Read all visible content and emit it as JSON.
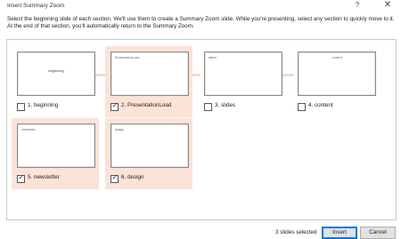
{
  "window": {
    "title": "Insert Summary Zoom",
    "help_glyph": "?",
    "close_glyph": "✕"
  },
  "instructions": "Select the beginning slide of each section. We'll use them to create a Summary Zoom slide. While you're presenting, select any section to quickly move to it. At the end of that section, you'll automatically return to the Summary Zoom.",
  "sections": [
    {
      "label": "1. beginning",
      "thumb_text": "beginning",
      "checked": false
    },
    {
      "label": "2. PresentationLoad",
      "thumb_text": "PresentationLoad",
      "checked": true
    },
    {
      "label": "3. slides",
      "thumb_text": "slides",
      "checked": false
    },
    {
      "label": "4. content",
      "thumb_text": "content",
      "checked": false
    },
    {
      "label": "5. newsletter",
      "thumb_text": "newsletter",
      "checked": true
    },
    {
      "label": "6. design",
      "thumb_text": "design",
      "checked": true
    }
  ],
  "checkmark_glyph": "✓",
  "footer": {
    "status": "3 slides selected",
    "insert_label": "Insert",
    "cancel_label": "Cancel"
  }
}
